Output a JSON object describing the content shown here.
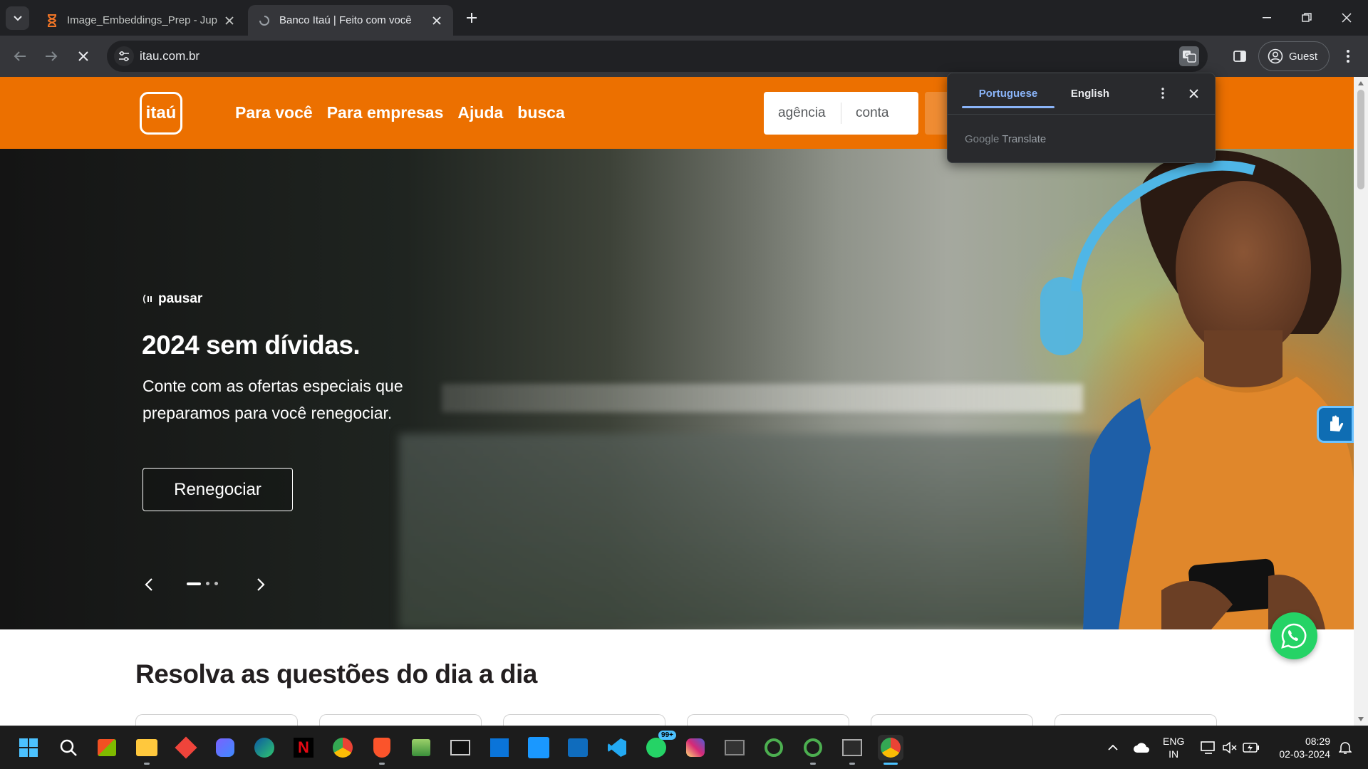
{
  "browser": {
    "tabs": [
      {
        "title": "Image_Embeddings_Prep - Jupyter",
        "active": false
      },
      {
        "title": "Banco Itaú | Feito com você",
        "active": true
      }
    ],
    "url": "itau.com.br",
    "profile_label": "Guest"
  },
  "header": {
    "logo_text": "itaú",
    "nav": [
      "Para você",
      "Para empresas",
      "Ajuda",
      "busca"
    ],
    "login": {
      "agency_placeholder": "agência",
      "account_placeholder": "conta"
    }
  },
  "hero": {
    "pause_label": "pausar",
    "headline": "2024 sem dívidas.",
    "subtext": "Conte com as ofertas especiais que preparamos para você renegociar.",
    "cta_label": "Renegociar",
    "slides_total": 3,
    "slide_active": 1
  },
  "section": {
    "title": "Resolva as questões do dia a dia"
  },
  "translate_popup": {
    "source_lang": "Portuguese",
    "target_lang": "English",
    "brand_google": "Google",
    "brand_translate": "Translate"
  },
  "taskbar": {
    "lang_line1": "ENG",
    "lang_line2": "IN",
    "time": "08:29",
    "date": "02-03-2024",
    "whatsapp_badge": "99+"
  },
  "colors": {
    "brand_orange": "#ec7000",
    "translate_accent": "#8ab4f8",
    "whatsapp": "#25d366"
  }
}
